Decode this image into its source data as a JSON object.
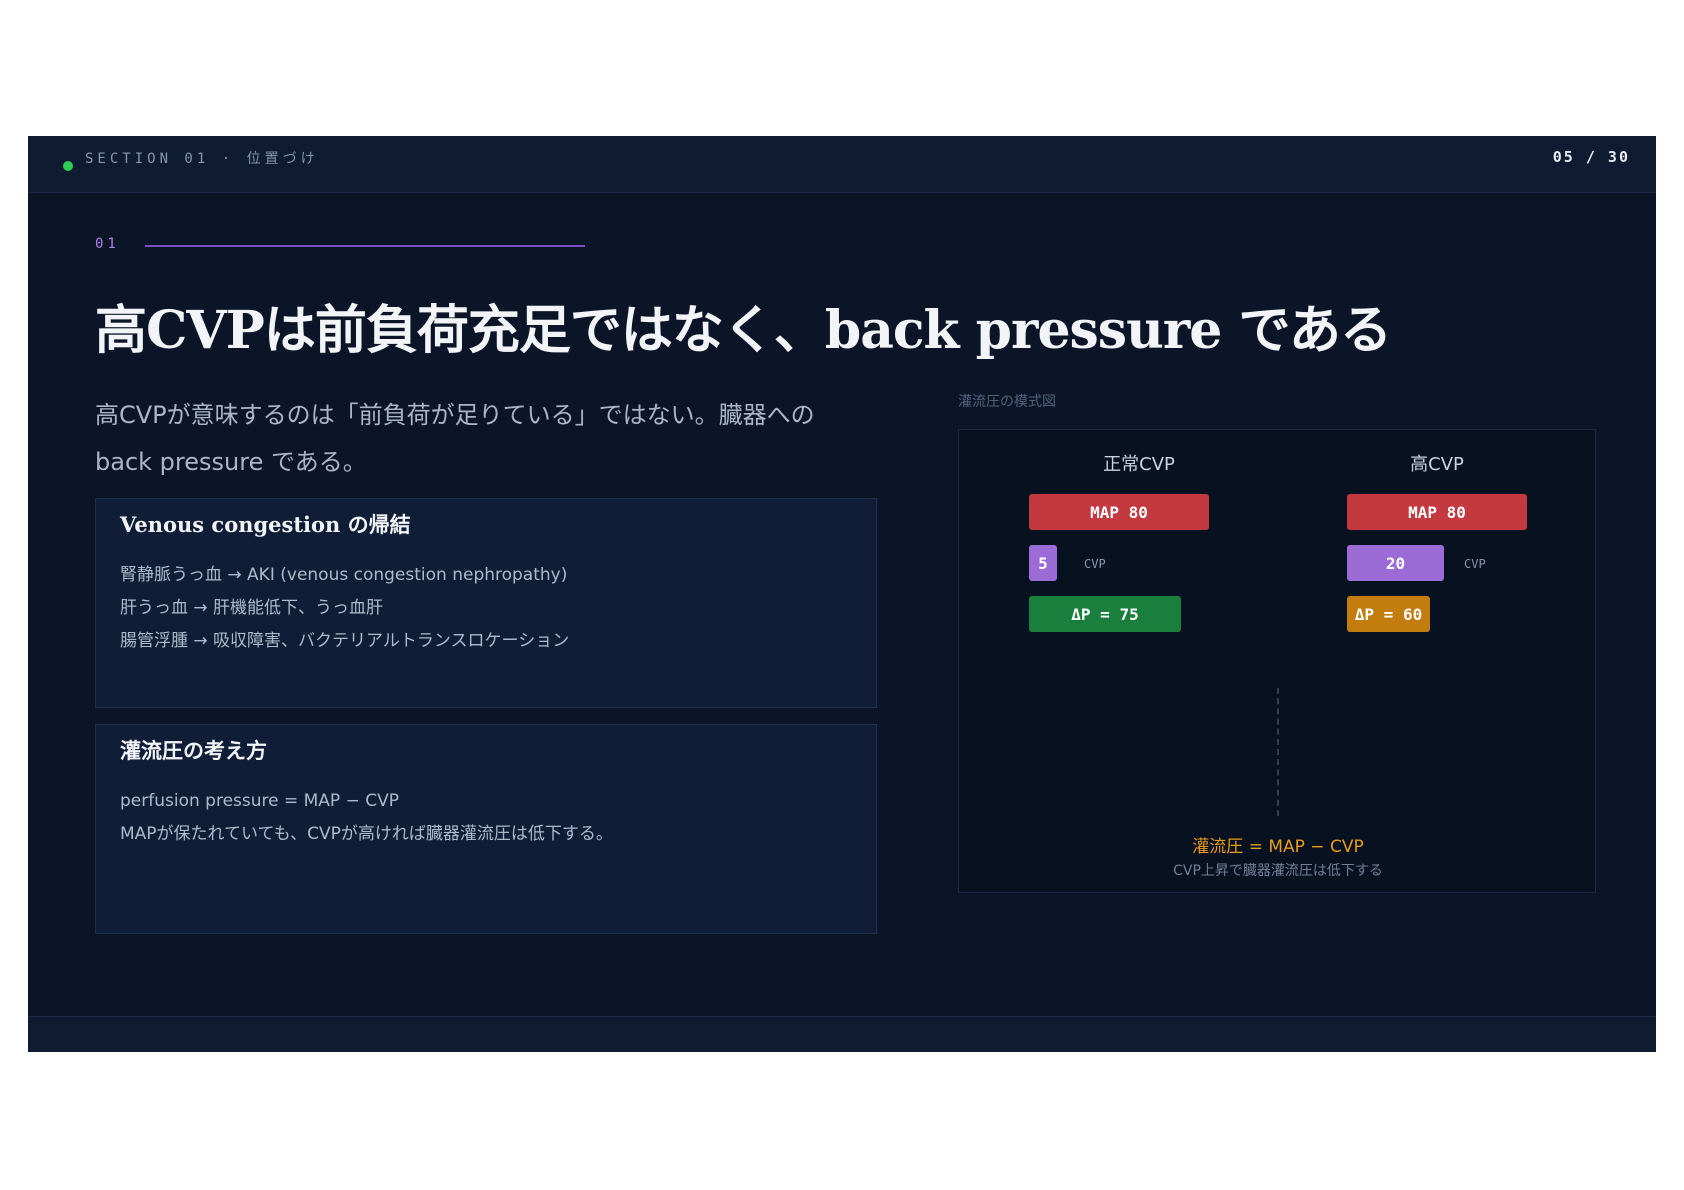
{
  "header": {
    "section": "SECTION 01  ·  位置づけ",
    "page": "05 / 30"
  },
  "index_label": "01",
  "title": "高CVPは前負荷充足ではなく、back pressure である",
  "lead": "高CVPが意味するのは「前負荷が足りている」ではない。臓器への back pressure である。",
  "cards": [
    {
      "title": "Venous congestion の帰結",
      "lines": [
        "腎静脈うっ血 → AKI (venous congestion nephropathy)",
        "肝うっ血 → 肝機能低下、うっ血肝",
        "腸管浮腫 → 吸収障害、バクテリアルトランスロケーション"
      ]
    },
    {
      "title": "灌流圧の考え方",
      "lines": [
        "perfusion pressure = MAP − CVP",
        "MAPが保たれていても、CVPが高ければ臓器灌流圧は低下する。"
      ]
    }
  ],
  "diagram": {
    "caption": "灌流圧の模式図",
    "columns": [
      {
        "heading": "正常CVP",
        "map_label": "MAP 80",
        "map": 80,
        "cvp_value": "5",
        "cvp": 5,
        "cvp_label": "CVP",
        "dp_label": "ΔP = 75",
        "dp": 75
      },
      {
        "heading": "高CVP",
        "map_label": "MAP 80",
        "map": 80,
        "cvp_value": "20",
        "cvp": 20,
        "cvp_label": "CVP",
        "dp_label": "ΔP = 60",
        "dp": 60
      }
    ],
    "formula": "灌流圧 = MAP − CVP",
    "note": "CVP上昇で臓器灌流圧は低下する"
  },
  "colors": {
    "background": "#0b1527",
    "map": "#c3393f",
    "cvp": "#9b6bd6",
    "dp_normal": "#1a7f3c",
    "dp_high": "#c27d0e",
    "accent_purple": "#b07fe6",
    "status_dot": "#2ecc52"
  }
}
